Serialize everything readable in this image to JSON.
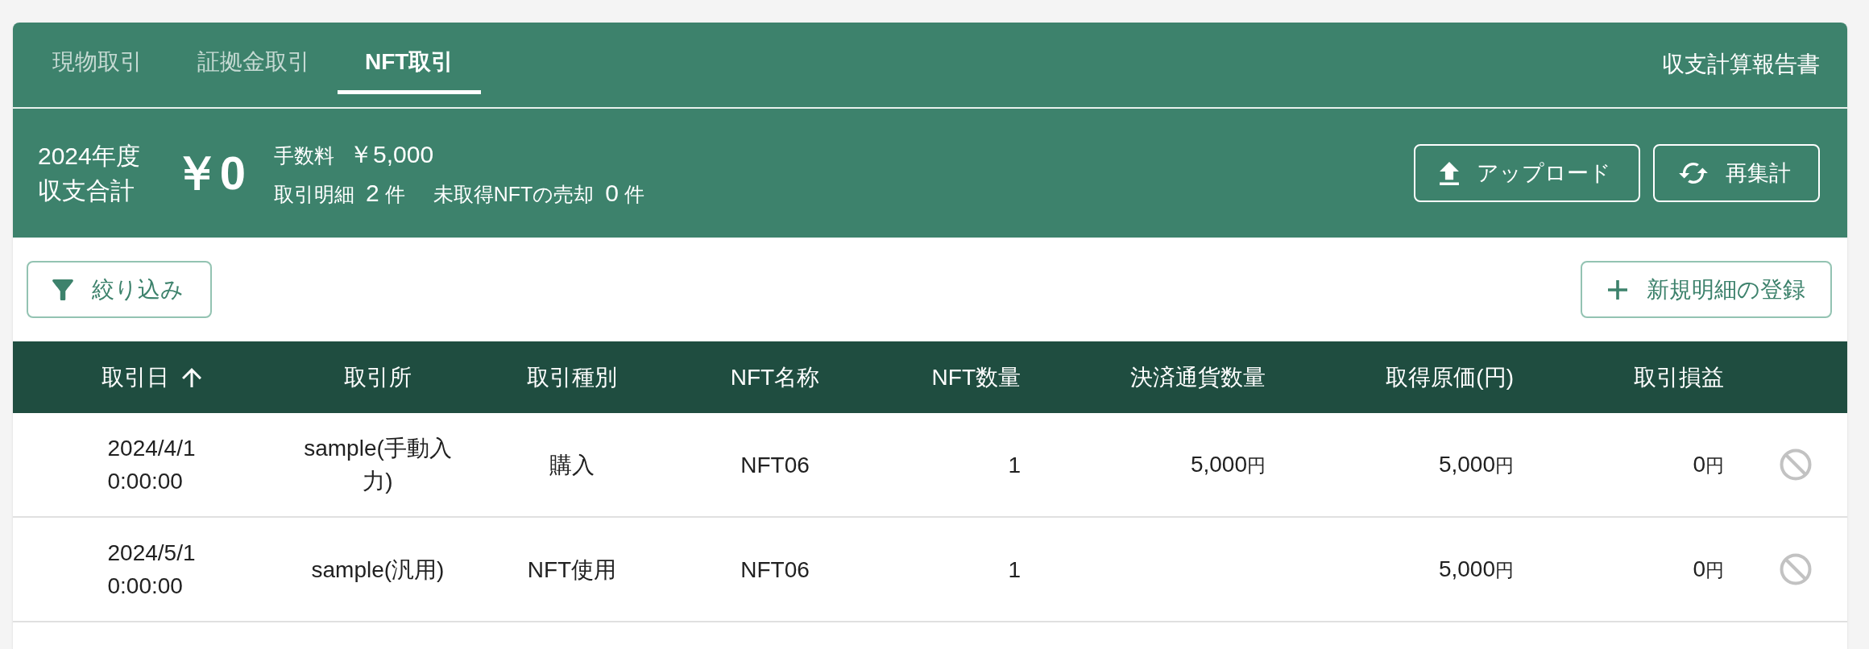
{
  "tabs": [
    {
      "label": "現物取引",
      "selected": false
    },
    {
      "label": "証拠金取引",
      "selected": false
    },
    {
      "label": "NFT取引",
      "selected": true
    }
  ],
  "report_link": "収支計算報告書",
  "summary": {
    "period": "2024年度",
    "label": "収支合計",
    "total": "￥0",
    "fee": {
      "label": "手数料",
      "value": "￥5,000"
    },
    "counts": [
      {
        "label": "取引明細",
        "value": "2",
        "unit": "件"
      },
      {
        "label": "未取得NFTの売却",
        "value": "0",
        "unit": "件"
      }
    ]
  },
  "actions": [
    {
      "kind": "upload",
      "label": "アップロード"
    },
    {
      "kind": "recalculate",
      "label": "再集計"
    }
  ],
  "toolbar": {
    "filter": "絞り込み",
    "add": "新規明細の登録"
  },
  "table": {
    "columns": [
      {
        "label": "取引日",
        "sorted": true
      },
      {
        "label": "取引所",
        "sorted": false
      },
      {
        "label": "取引種別",
        "sorted": false
      },
      {
        "label": "NFT名称",
        "sorted": false
      },
      {
        "label": "NFT数量",
        "sorted": false
      },
      {
        "label": "決済通貨数量",
        "sorted": false
      },
      {
        "label": "取得原価(円)",
        "sorted": false
      },
      {
        "label": "取引損益",
        "sorted": false
      }
    ],
    "rows": [
      {
        "date": "2024/4/1 0:00:00",
        "exchange": "sample(手動入力)",
        "type": "購入",
        "nft_name": "NFT06",
        "nft_quantity": "1",
        "settlement_amount": {
          "value": "5,000",
          "unit": "円"
        },
        "acquisition_cost": {
          "value": "5,000",
          "unit": "円"
        },
        "profit": {
          "value": "0",
          "unit": "円"
        },
        "disabled": true
      },
      {
        "date": "2024/5/1 0:00:00",
        "exchange": "sample(汎用)",
        "type": "NFT使用",
        "nft_name": "NFT06",
        "nft_quantity": "1",
        "acquisition_cost": {
          "value": "5,000",
          "unit": "円"
        },
        "profit": {
          "value": "0",
          "unit": "円"
        },
        "disabled": true
      }
    ]
  }
}
